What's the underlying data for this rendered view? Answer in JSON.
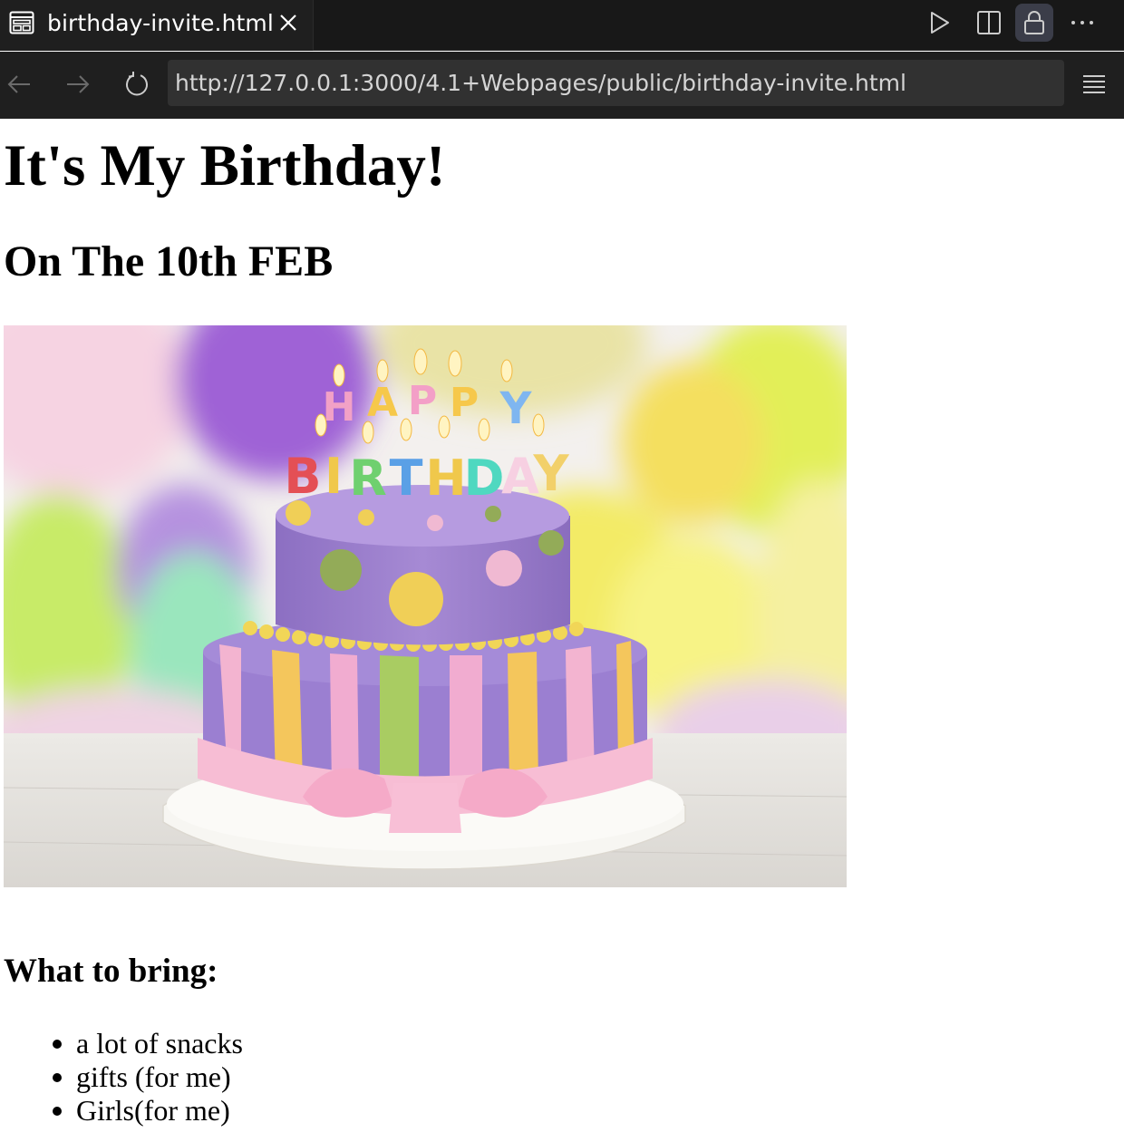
{
  "tab": {
    "title": "birthday-invite.html"
  },
  "address_bar": {
    "url": "http://127.0.0.1:3000/4.1+Webpages/public/birthday-invite.html"
  },
  "toolbar_icons": [
    "preview-icon",
    "close-icon",
    "play-icon",
    "split-editor-icon",
    "lock-icon",
    "more-icon",
    "back-arrow-icon",
    "forward-arrow-icon",
    "reload-icon",
    "menu-icon"
  ],
  "colors": {
    "chrome_background": "#181818",
    "address_field": "#313131",
    "active_button": "#3b3d49",
    "page_background": "#ffffff"
  },
  "page": {
    "heading": "It's My Birthday!",
    "date_heading": "On The 10th FEB",
    "cake_image": {
      "candle_letters": [
        "H",
        "A",
        "P",
        "P",
        "Y",
        "B",
        "I",
        "R",
        "T",
        "H",
        "D",
        "A",
        "Y"
      ]
    },
    "bring_heading": "What to bring:",
    "bring_items": [
      "a lot of snacks",
      "gifts (for me)",
      "Girls(for me)"
    ]
  }
}
